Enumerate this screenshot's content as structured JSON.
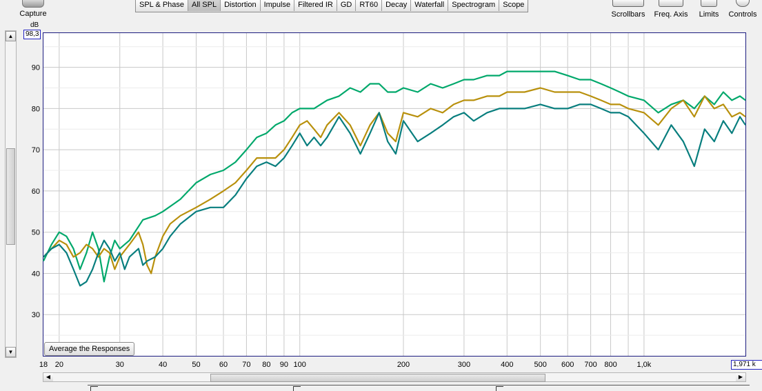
{
  "toolbar": {
    "capture_label": "Capture",
    "tabs": [
      {
        "label": "SPL & Phase",
        "active": false
      },
      {
        "label": "All SPL",
        "active": true
      },
      {
        "label": "Distortion",
        "active": false
      },
      {
        "label": "Impulse",
        "active": false
      },
      {
        "label": "Filtered IR",
        "active": false
      },
      {
        "label": "GD",
        "active": false
      },
      {
        "label": "RT60",
        "active": false
      },
      {
        "label": "Decay",
        "active": false
      },
      {
        "label": "Waterfall",
        "active": false
      },
      {
        "label": "Spectrogram",
        "active": false
      },
      {
        "label": "Scope",
        "active": false
      }
    ],
    "scrollbars_label": "Scrollbars",
    "freq_axis_label": "Freq. Axis",
    "limits_label": "Limits",
    "controls_label": "Controls"
  },
  "average_button_label": "Average the Responses",
  "y_limit_readout": "98,3",
  "x_limit_readout": "1,971 k",
  "colors": {
    "series1": "#00a86b",
    "series2": "#b8900c",
    "series3": "#087e7e",
    "grid": "#c8c8c8",
    "plot_border": "#1b1b7f"
  },
  "chart_data": {
    "type": "line",
    "x_scale": "log",
    "xlim": [
      18,
      1971
    ],
    "ylim": [
      20,
      98.3
    ],
    "ylabel": "dB",
    "grid": true,
    "y_ticks": [
      30,
      40,
      50,
      60,
      70,
      80,
      90
    ],
    "x_ticks": [
      {
        "v": 18,
        "l": "18"
      },
      {
        "v": 20,
        "l": "20"
      },
      {
        "v": 30,
        "l": "30"
      },
      {
        "v": 40,
        "l": "40"
      },
      {
        "v": 50,
        "l": "50"
      },
      {
        "v": 60,
        "l": "60"
      },
      {
        "v": 70,
        "l": "70"
      },
      {
        "v": 80,
        "l": "80"
      },
      {
        "v": 90,
        "l": "90"
      },
      {
        "v": 100,
        "l": "100"
      },
      {
        "v": 200,
        "l": "200"
      },
      {
        "v": 300,
        "l": "300"
      },
      {
        "v": 400,
        "l": "400"
      },
      {
        "v": 500,
        "l": "500"
      },
      {
        "v": 600,
        "l": "600"
      },
      {
        "v": 700,
        "l": "700"
      },
      {
        "v": 800,
        "l": "800"
      },
      {
        "v": 1000,
        "l": "1,0k"
      }
    ],
    "series": [
      {
        "color": "#00a86b",
        "points": [
          [
            18,
            43
          ],
          [
            19,
            47
          ],
          [
            20,
            50
          ],
          [
            21,
            49
          ],
          [
            22,
            46
          ],
          [
            23,
            41
          ],
          [
            24,
            45
          ],
          [
            25,
            50
          ],
          [
            26,
            46
          ],
          [
            27,
            38
          ],
          [
            28,
            44
          ],
          [
            29,
            48
          ],
          [
            30,
            46
          ],
          [
            32,
            48
          ],
          [
            35,
            53
          ],
          [
            38,
            54
          ],
          [
            40,
            55
          ],
          [
            45,
            58
          ],
          [
            50,
            62
          ],
          [
            55,
            64
          ],
          [
            60,
            65
          ],
          [
            65,
            67
          ],
          [
            70,
            70
          ],
          [
            75,
            73
          ],
          [
            80,
            74
          ],
          [
            85,
            76
          ],
          [
            90,
            77
          ],
          [
            95,
            79
          ],
          [
            100,
            80
          ],
          [
            110,
            80
          ],
          [
            120,
            82
          ],
          [
            130,
            83
          ],
          [
            140,
            85
          ],
          [
            150,
            84
          ],
          [
            160,
            86
          ],
          [
            170,
            86
          ],
          [
            180,
            84
          ],
          [
            190,
            84
          ],
          [
            200,
            85
          ],
          [
            220,
            84
          ],
          [
            240,
            86
          ],
          [
            260,
            85
          ],
          [
            280,
            86
          ],
          [
            300,
            87
          ],
          [
            320,
            87
          ],
          [
            350,
            88
          ],
          [
            380,
            88
          ],
          [
            400,
            89
          ],
          [
            450,
            89
          ],
          [
            500,
            89
          ],
          [
            550,
            89
          ],
          [
            600,
            88
          ],
          [
            650,
            87
          ],
          [
            700,
            87
          ],
          [
            750,
            86
          ],
          [
            800,
            85
          ],
          [
            850,
            84
          ],
          [
            900,
            83
          ],
          [
            1000,
            82
          ],
          [
            1100,
            79
          ],
          [
            1200,
            81
          ],
          [
            1300,
            82
          ],
          [
            1400,
            80
          ],
          [
            1500,
            83
          ],
          [
            1600,
            81
          ],
          [
            1700,
            84
          ],
          [
            1800,
            82
          ],
          [
            1900,
            83
          ],
          [
            1971,
            82
          ]
        ]
      },
      {
        "color": "#b8900c",
        "points": [
          [
            18,
            44
          ],
          [
            19,
            46
          ],
          [
            20,
            48
          ],
          [
            21,
            47
          ],
          [
            22,
            44
          ],
          [
            23,
            45
          ],
          [
            24,
            47
          ],
          [
            25,
            46
          ],
          [
            26,
            44
          ],
          [
            27,
            46
          ],
          [
            28,
            45
          ],
          [
            29,
            41
          ],
          [
            30,
            44
          ],
          [
            32,
            47
          ],
          [
            34,
            50
          ],
          [
            35,
            47
          ],
          [
            36,
            42
          ],
          [
            37,
            40
          ],
          [
            38,
            44
          ],
          [
            40,
            49
          ],
          [
            42,
            52
          ],
          [
            45,
            54
          ],
          [
            50,
            56
          ],
          [
            55,
            58
          ],
          [
            60,
            60
          ],
          [
            65,
            62
          ],
          [
            70,
            65
          ],
          [
            75,
            68
          ],
          [
            80,
            68
          ],
          [
            85,
            68
          ],
          [
            90,
            70
          ],
          [
            95,
            73
          ],
          [
            100,
            76
          ],
          [
            105,
            77
          ],
          [
            110,
            75
          ],
          [
            115,
            73
          ],
          [
            120,
            76
          ],
          [
            130,
            79
          ],
          [
            140,
            76
          ],
          [
            150,
            71
          ],
          [
            160,
            76
          ],
          [
            170,
            79
          ],
          [
            180,
            74
          ],
          [
            190,
            72
          ],
          [
            200,
            79
          ],
          [
            220,
            78
          ],
          [
            240,
            80
          ],
          [
            260,
            79
          ],
          [
            280,
            81
          ],
          [
            300,
            82
          ],
          [
            320,
            82
          ],
          [
            350,
            83
          ],
          [
            380,
            83
          ],
          [
            400,
            84
          ],
          [
            450,
            84
          ],
          [
            500,
            85
          ],
          [
            550,
            84
          ],
          [
            600,
            84
          ],
          [
            650,
            84
          ],
          [
            700,
            83
          ],
          [
            750,
            82
          ],
          [
            800,
            81
          ],
          [
            850,
            81
          ],
          [
            900,
            80
          ],
          [
            1000,
            79
          ],
          [
            1100,
            76
          ],
          [
            1200,
            80
          ],
          [
            1300,
            82
          ],
          [
            1400,
            78
          ],
          [
            1500,
            83
          ],
          [
            1600,
            80
          ],
          [
            1700,
            81
          ],
          [
            1800,
            78
          ],
          [
            1900,
            79
          ],
          [
            1971,
            78
          ]
        ]
      },
      {
        "color": "#087e7e",
        "points": [
          [
            18,
            44
          ],
          [
            19,
            46
          ],
          [
            20,
            47
          ],
          [
            21,
            45
          ],
          [
            22,
            41
          ],
          [
            23,
            37
          ],
          [
            24,
            38
          ],
          [
            25,
            41
          ],
          [
            26,
            45
          ],
          [
            27,
            48
          ],
          [
            28,
            46
          ],
          [
            29,
            43
          ],
          [
            30,
            45
          ],
          [
            31,
            41
          ],
          [
            32,
            44
          ],
          [
            34,
            46
          ],
          [
            35,
            42
          ],
          [
            36,
            43
          ],
          [
            38,
            44
          ],
          [
            40,
            46
          ],
          [
            42,
            49
          ],
          [
            45,
            52
          ],
          [
            50,
            55
          ],
          [
            55,
            56
          ],
          [
            60,
            56
          ],
          [
            65,
            59
          ],
          [
            70,
            63
          ],
          [
            75,
            66
          ],
          [
            80,
            67
          ],
          [
            85,
            66
          ],
          [
            90,
            68
          ],
          [
            95,
            71
          ],
          [
            100,
            74
          ],
          [
            105,
            71
          ],
          [
            110,
            73
          ],
          [
            115,
            71
          ],
          [
            120,
            73
          ],
          [
            130,
            78
          ],
          [
            140,
            74
          ],
          [
            150,
            69
          ],
          [
            160,
            74
          ],
          [
            170,
            79
          ],
          [
            180,
            72
          ],
          [
            190,
            69
          ],
          [
            200,
            77
          ],
          [
            220,
            72
          ],
          [
            240,
            74
          ],
          [
            260,
            76
          ],
          [
            280,
            78
          ],
          [
            300,
            79
          ],
          [
            320,
            77
          ],
          [
            350,
            79
          ],
          [
            380,
            80
          ],
          [
            400,
            80
          ],
          [
            450,
            80
          ],
          [
            500,
            81
          ],
          [
            550,
            80
          ],
          [
            600,
            80
          ],
          [
            650,
            81
          ],
          [
            700,
            81
          ],
          [
            750,
            80
          ],
          [
            800,
            79
          ],
          [
            850,
            79
          ],
          [
            900,
            78
          ],
          [
            1000,
            74
          ],
          [
            1100,
            70
          ],
          [
            1200,
            76
          ],
          [
            1300,
            72
          ],
          [
            1400,
            66
          ],
          [
            1500,
            75
          ],
          [
            1600,
            72
          ],
          [
            1700,
            77
          ],
          [
            1800,
            74
          ],
          [
            1900,
            78
          ],
          [
            1971,
            76
          ]
        ]
      }
    ]
  }
}
